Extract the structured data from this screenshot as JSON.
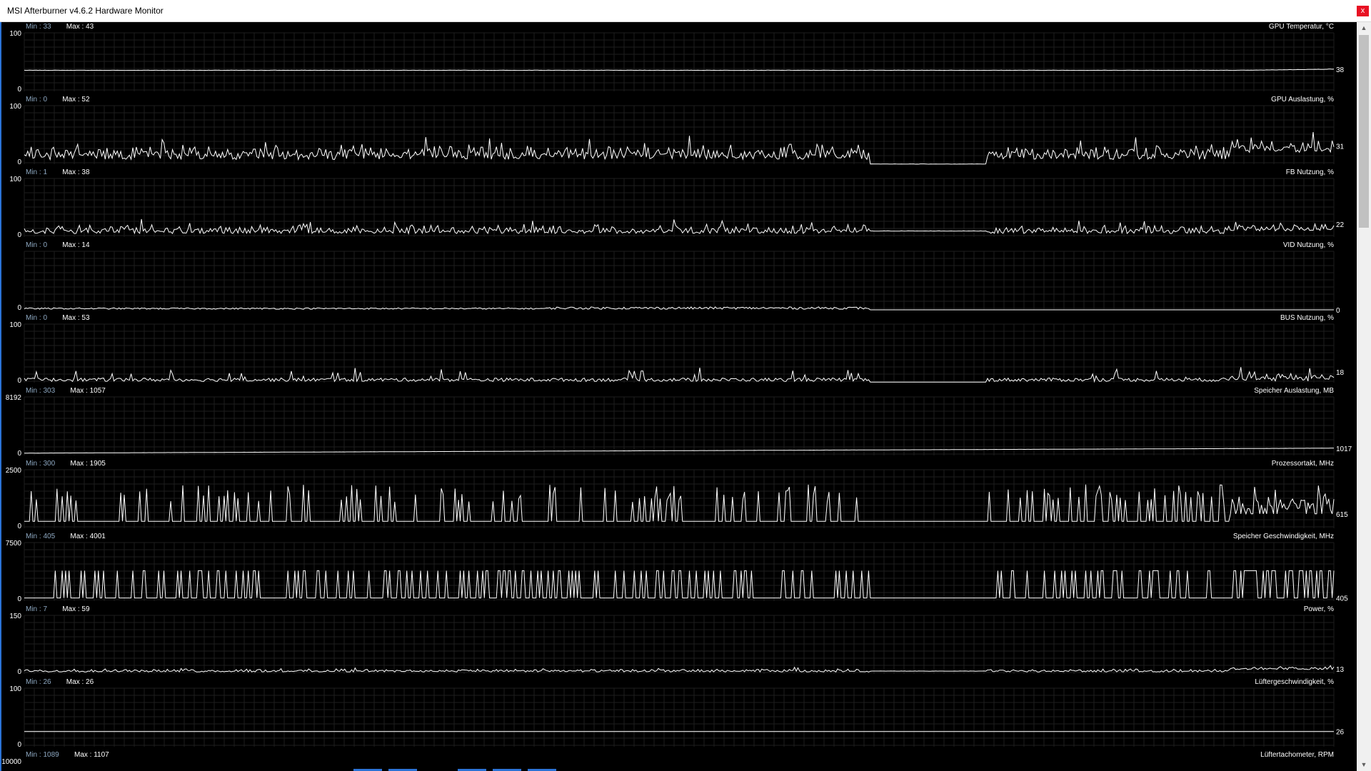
{
  "window": {
    "title": "MSI Afterburner v4.6.2 Hardware Monitor",
    "close_label": "x"
  },
  "colors": {
    "background": "#000000",
    "grid": "#1e1e1e",
    "line": "#ffffff",
    "min_text": "#8ea8c2",
    "text": "#ffffff",
    "accent": "#2b73d6"
  },
  "icons": {
    "close": "close-icon",
    "scroll_up": "chevron-up-icon",
    "scroll_down": "chevron-down-icon"
  },
  "chart_data": [
    {
      "type": "line",
      "title": "GPU Temperatur, °C",
      "min_label": "Min : 33",
      "max_label": "Max : 43",
      "current": "38",
      "y_max_label": "100",
      "y_min_label": "0",
      "ylim": [
        0,
        100
      ],
      "pattern": "flat",
      "level": 36,
      "end_level": 38,
      "noise": 0.4
    },
    {
      "type": "line",
      "title": "GPU Auslastung, %",
      "min_label": "Min : 0",
      "max_label": "Max : 52",
      "current": "31",
      "y_max_label": "100",
      "y_min_label": "0",
      "ylim": [
        0,
        100
      ],
      "pattern": "noisy",
      "base": 8,
      "amp": 28,
      "gap": true,
      "end_boost": 12
    },
    {
      "type": "line",
      "title": "FB Nutzung, %",
      "min_label": "Min : 1",
      "max_label": "Max : 38",
      "current": "22",
      "y_max_label": "100",
      "y_min_label": "0",
      "ylim": [
        0,
        100
      ],
      "pattern": "noisy",
      "base": 6,
      "amp": 16,
      "gap": true,
      "gap_level": 10,
      "end_boost": 4
    },
    {
      "type": "line",
      "title": "VID Nutzung, %",
      "min_label": "Min : 0",
      "max_label": "Max : 14",
      "current": "0",
      "y_max_label": "",
      "y_min_label": "0",
      "ylim": [
        0,
        100
      ],
      "pattern": "low",
      "base": 1,
      "amp": 4,
      "gap": true,
      "gap_level": 0,
      "tail_zero": true
    },
    {
      "type": "line",
      "title": "BUS Nutzung, %",
      "min_label": "Min : 0",
      "max_label": "Max : 53",
      "current": "18",
      "y_max_label": "100",
      "y_min_label": "0",
      "ylim": [
        0,
        100
      ],
      "pattern": "spiky",
      "base": 2,
      "amp": 12,
      "gap": true,
      "gap_level": 1,
      "end_boost": 8
    },
    {
      "type": "line",
      "title": "Speicher Auslastung, MB",
      "min_label": "Min : 303",
      "max_label": "Max : 1057",
      "current": "1017",
      "y_max_label": "8192",
      "y_min_label": "0",
      "ylim": [
        0,
        8192
      ],
      "pattern": "ramp",
      "start": 330,
      "end": 1017
    },
    {
      "type": "line",
      "title": "Prozessortakt, MHz",
      "min_label": "Min : 300",
      "max_label": "Max : 1905",
      "current": "615",
      "y_max_label": "2500",
      "y_min_label": "0",
      "ylim": [
        0,
        2500
      ],
      "pattern": "pulse",
      "base": 300,
      "peak": 1500,
      "gap": true,
      "end_base": 615
    },
    {
      "type": "line",
      "title": "Speicher Geschwindigkeit, MHz",
      "min_label": "Min : 405",
      "max_label": "Max : 4001",
      "current": "405",
      "y_max_label": "7500",
      "y_min_label": "0",
      "ylim": [
        0,
        7500
      ],
      "pattern": "square",
      "base": 405,
      "peak": 3900,
      "gap": true
    },
    {
      "type": "line",
      "title": "Power, %",
      "min_label": "Min : 7",
      "max_label": "Max : 59",
      "current": "13",
      "y_max_label": "150",
      "y_min_label": "0",
      "ylim": [
        0,
        150
      ],
      "pattern": "noisy",
      "base": 5,
      "amp": 8,
      "gap": true,
      "gap_level": 7,
      "end_boost": 6
    },
    {
      "type": "line",
      "title": "Lüftergeschwindigkeit, %",
      "min_label": "Min : 26",
      "max_label": "Max : 26",
      "current": "26",
      "y_max_label": "100",
      "y_min_label": "0",
      "ylim": [
        0,
        100
      ],
      "pattern": "flat",
      "level": 26,
      "end_level": 26,
      "noise": 0
    },
    {
      "type": "line",
      "title": "Lüftertachometer, RPM",
      "min_label": "Min : 1089",
      "max_label": "Max : 1107",
      "current": "",
      "y_max_label": "10000",
      "y_min_label": "",
      "ylim": [
        0,
        10000
      ],
      "pattern": "none"
    }
  ]
}
